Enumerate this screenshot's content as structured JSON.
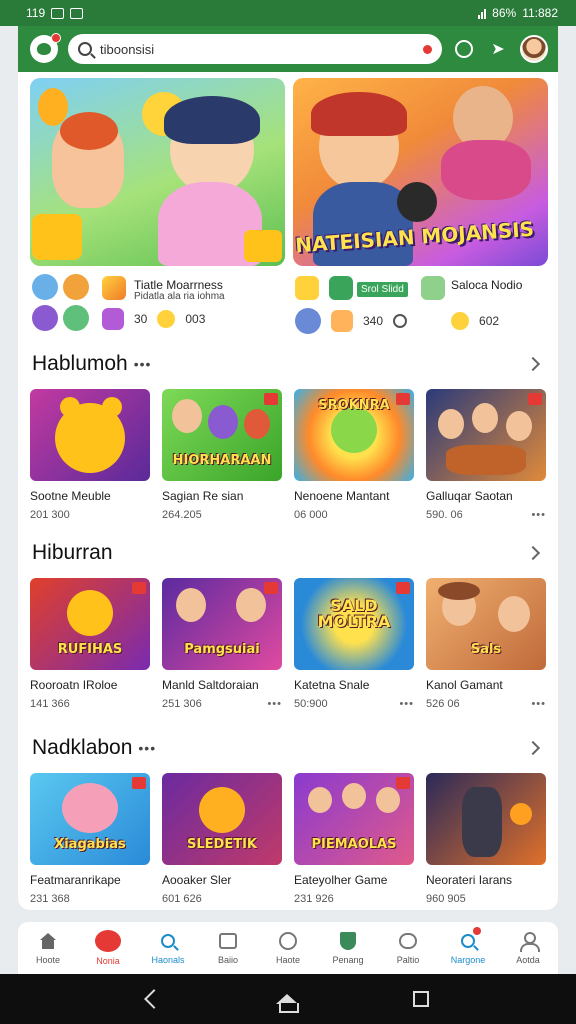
{
  "status_bar": {
    "time": "119",
    "battery": "86%",
    "clock": "11:882"
  },
  "search": {
    "value": "tiboonsisi"
  },
  "hero": {
    "banners": [
      {
        "title": ""
      },
      {
        "title": "NATEISIAN MOJANSIS"
      }
    ],
    "items": [
      {
        "label": "Tiatle Moarrness",
        "sub": "Pidatla ala ria iohma",
        "stat1": "30",
        "stat2": "003"
      },
      {
        "label": "Saloca Nodio",
        "badge": "Srol Slidd",
        "stat1": "340",
        "stat2": "602"
      }
    ]
  },
  "sections": [
    {
      "title": "Hablumoh",
      "tiles": [
        {
          "art_text": "",
          "name": "Sootne Meuble",
          "count": "201 300"
        },
        {
          "art_text": "HIORHARAAN",
          "name": "Sagian Re sian",
          "count": "264.205"
        },
        {
          "art_text": "SROKNRA",
          "name": "Nenoene Mantant",
          "count": "06 000"
        },
        {
          "art_text": "",
          "name": "Galluqar Saotan",
          "count": "590. 06"
        }
      ]
    },
    {
      "title": "Hiburran",
      "tiles": [
        {
          "art_text": "RUFIHAS",
          "name": "Rooroatn IRoloe",
          "count": "141 366"
        },
        {
          "art_text": "Pamgsuiai",
          "name": "Manld Saltdoraian",
          "count": "251 306"
        },
        {
          "art_text": "SALD MOLTRA",
          "name": "Katetna Snale",
          "count": "50:900"
        },
        {
          "art_text": "Sals",
          "name": "Kanol Gamant",
          "count": "526 06"
        }
      ]
    },
    {
      "title": "Nadklabon",
      "tiles": [
        {
          "art_text": "Xiagabias",
          "name": "Featmaranrikape",
          "count": "231 368"
        },
        {
          "art_text": "SLEDETIK",
          "name": "Aooaker Sler",
          "count": "601 626"
        },
        {
          "art_text": "PIEMAOLAS",
          "name": "Eateyolher Game",
          "count": "231 926"
        },
        {
          "art_text": "",
          "name": "Neorateri Iarans",
          "count": "960 905"
        }
      ]
    }
  ],
  "bottom_nav": [
    {
      "label": "Hoote"
    },
    {
      "label": "Nonia"
    },
    {
      "label": "Haonals"
    },
    {
      "label": "Baiio"
    },
    {
      "label": "Haote"
    },
    {
      "label": "Penang"
    },
    {
      "label": "Paltio"
    },
    {
      "label": "Nargone"
    },
    {
      "label": "Aotda"
    }
  ],
  "colors": {
    "brand_green": "#2d8a3e",
    "accent_red": "#e53935",
    "accent_blue": "#1b8cc9"
  }
}
